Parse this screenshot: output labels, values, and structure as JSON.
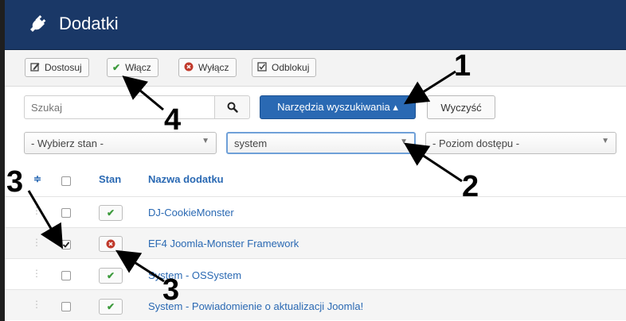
{
  "header": {
    "title": "Dodatki",
    "icon": "plug-icon"
  },
  "toolbar": {
    "customize": "Dostosuj",
    "enable": "Włącz",
    "disable": "Wyłącz",
    "unlock": "Odblokuj"
  },
  "search": {
    "placeholder": "Szukaj",
    "tools_label": "Narzędzia wyszukiwania ▴",
    "clear_label": "Wyczyść"
  },
  "filters": {
    "state": "- Wybierz stan -",
    "type": "system",
    "access": "- Poziom dostępu -"
  },
  "table": {
    "sort_icon": "≑",
    "col_state": "Stan",
    "col_name": "Nazwa dodatku",
    "rows": [
      {
        "name": "DJ-CookieMonster",
        "enabled": true,
        "checked": false
      },
      {
        "name": "EF4 Joomla-Monster Framework",
        "enabled": false,
        "checked": true
      },
      {
        "name": "System - OSSystem",
        "enabled": true,
        "checked": false
      },
      {
        "name": "System - Powiadomienie o aktualizacji Joomla!",
        "enabled": true,
        "checked": false
      }
    ]
  },
  "annotations": {
    "a1": "1",
    "a2": "2",
    "a3a": "3",
    "a3b": "3",
    "a4": "4"
  },
  "colors": {
    "header_bg": "#1a3867",
    "primary": "#2a69b3",
    "success": "#3c9a3c",
    "danger": "#c0392b"
  }
}
